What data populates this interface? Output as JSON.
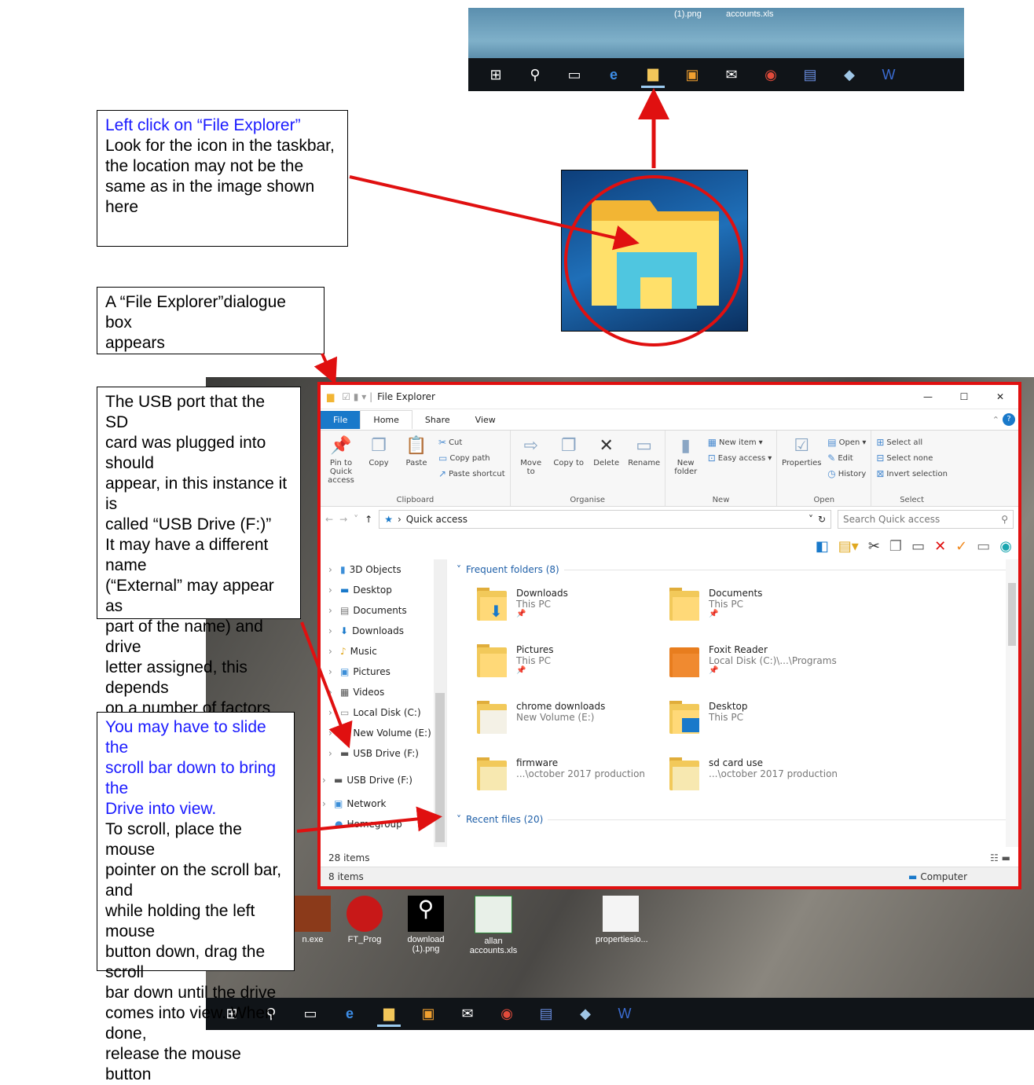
{
  "callouts": {
    "file_explorer": {
      "line1": "Left click on “File Explorer”",
      "line2": "Look for the icon in the taskbar,",
      "line3": "the location may not be the",
      "line4": "same as in the image shown here"
    },
    "dialogue": {
      "line1": "A “File Explorer”dialogue box",
      "line2": "appears"
    },
    "usb": {
      "line1": "The USB port that the SD",
      "line2": "card was plugged into should",
      "line3": "appear, in this instance it is",
      "line4": "called “USB Drive (F:)”",
      "line5": "It may have a different name",
      "line6": "(“External” may appear as",
      "line7": "part of the name) and drive",
      "line8": "letter assigned, this depends",
      "line9": "on a number of factors"
    },
    "scroll": {
      "line1": "You may have to slide the",
      "line2": "scroll bar down to bring the",
      "line3": "Drive into view.",
      "line4": "To scroll, place the mouse",
      "line5": "pointer on the scroll bar, and",
      "line6": "while holding the left mouse",
      "line7": "button down, drag the scroll",
      "line8": "bar down until the drive",
      "line9": "comes into view. When done,",
      "line10": "release the mouse button"
    }
  },
  "top_crop": {
    "labels": [
      "(1).png",
      "accounts.xls"
    ]
  },
  "window": {
    "title": "File Explorer",
    "ribbon_tabs": [
      "File",
      "Home",
      "Share",
      "View"
    ],
    "ribbon": {
      "clipboard": {
        "name": "Clipboard",
        "pin": "Pin to Quick access",
        "copy": "Copy",
        "paste": "Paste",
        "cut": "Cut",
        "copy_path": "Copy path",
        "paste_shortcut": "Paste shortcut"
      },
      "organise": {
        "name": "Organise",
        "move": "Move to",
        "copy_to": "Copy to",
        "delete": "Delete",
        "rename": "Rename"
      },
      "new": {
        "name": "New",
        "new_folder": "New folder",
        "new_item": "New item",
        "easy_access": "Easy access"
      },
      "open": {
        "name": "Open",
        "properties": "Properties",
        "open": "Open",
        "edit": "Edit",
        "history": "History"
      },
      "select": {
        "name": "Select",
        "select_all": "Select all",
        "select_none": "Select none",
        "invert": "Invert selection"
      }
    },
    "address": "Quick access",
    "search_placeholder": "Search Quick access",
    "nav": [
      "3D Objects",
      "Desktop",
      "Documents",
      "Downloads",
      "Music",
      "Pictures",
      "Videos",
      "Local Disk (C:)",
      "New Volume (E:)",
      "USB Drive (F:)",
      "USB Drive (F:)",
      "Network",
      "Homegroup"
    ],
    "frequent_header": "Frequent folders (8)",
    "recent_header": "Recent files (20)",
    "folders": [
      {
        "name": "Downloads",
        "loc": "This PC",
        "pin": "📌"
      },
      {
        "name": "Documents",
        "loc": "This PC",
        "pin": "📌"
      },
      {
        "name": "Pictures",
        "loc": "This PC",
        "pin": "📌"
      },
      {
        "name": "Foxit Reader",
        "loc": "Local Disk (C:)\\...\\Programs",
        "pin": "📌"
      },
      {
        "name": "chrome downloads",
        "loc": "New Volume (E:)",
        "pin": ""
      },
      {
        "name": "Desktop",
        "loc": "This PC",
        "pin": ""
      },
      {
        "name": "firmware",
        "loc": "...\\october 2017 production",
        "pin": ""
      },
      {
        "name": "sd card use",
        "loc": "...\\october 2017 production",
        "pin": ""
      }
    ],
    "status_items": "28 items",
    "status_items_2": "8 items",
    "status_computer": "Computer"
  },
  "desktop_icons": [
    {
      "label": "n.exe"
    },
    {
      "label": "FT_Prog"
    },
    {
      "label": "download (1).png"
    },
    {
      "label": "allan accounts.xls"
    },
    {
      "label": "propertiesio..."
    }
  ],
  "colors": {
    "accent": "#1979ca",
    "highlight": "#e01010",
    "link": "#1a1aff"
  }
}
